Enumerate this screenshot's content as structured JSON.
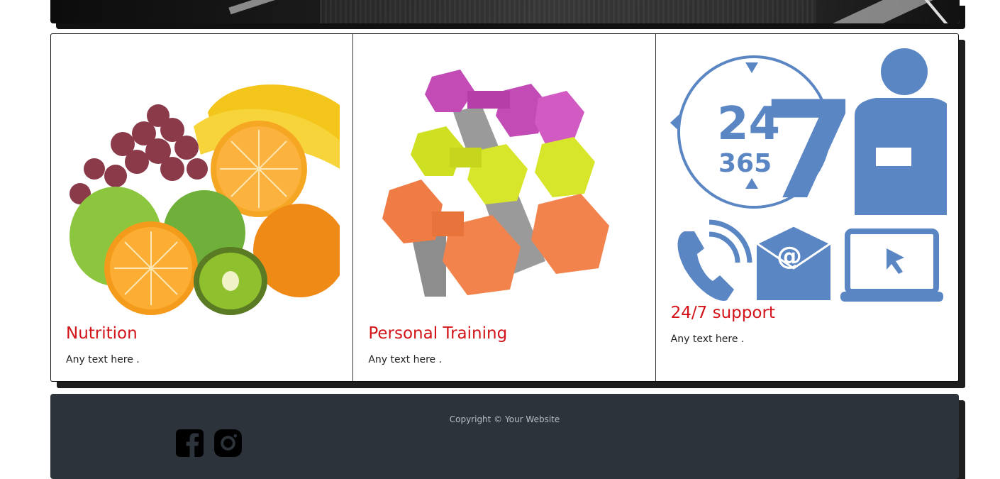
{
  "hero": {
    "image_name": "gym-hero-image"
  },
  "cards": [
    {
      "title": "Nutrition",
      "text": "Any text here .",
      "image_icon": "fruit-bowl-image"
    },
    {
      "title": "Personal Training",
      "text": "Any text here .",
      "image_icon": "dumbbells-image"
    },
    {
      "title": "24/7 support",
      "text": "Any text here .",
      "image_icon": "support-icons-image",
      "icon_text": {
        "big": "24",
        "small": "365",
        "seven": "7",
        "at": "@"
      }
    }
  ],
  "footer": {
    "copyright": "Copyright © Your Website",
    "social": [
      {
        "icon": "facebook-icon"
      },
      {
        "icon": "instagram-icon"
      }
    ]
  },
  "colors": {
    "title_red": "#d2141a",
    "support_blue": "#5b86c4",
    "footer_bg": "#2c333a"
  }
}
